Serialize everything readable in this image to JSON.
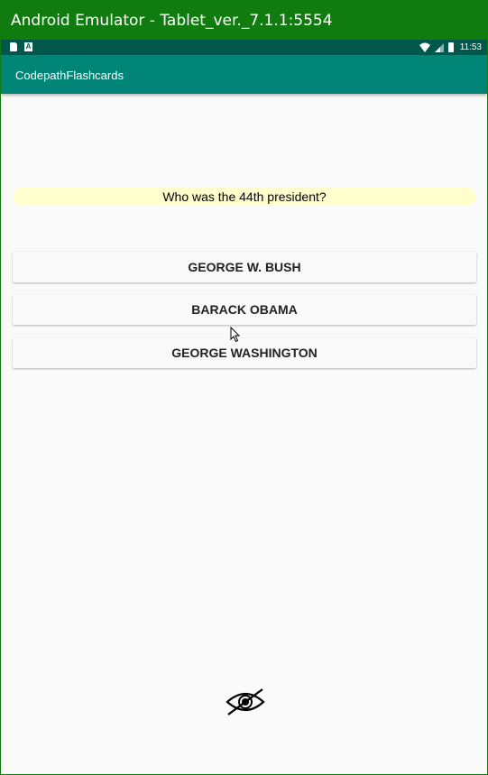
{
  "window": {
    "title": "Android Emulator - Tablet_ver._7.1.1:5554"
  },
  "statusbar": {
    "left_icons": [
      "sd-card-icon",
      "notification-a-icon"
    ],
    "right_icons": [
      "wifi-icon",
      "cell-signal-icon",
      "battery-icon"
    ],
    "time": "11:53",
    "notification_letter": "A"
  },
  "appbar": {
    "title": "CodepathFlashcards"
  },
  "flashcard": {
    "question": "Who was the 44th president?",
    "answers": [
      {
        "label": "GEORGE W. BUSH"
      },
      {
        "label": "BARACK OBAMA"
      },
      {
        "label": "GEORGE WASHINGTON"
      }
    ],
    "toggle_icon": "eye-hidden-icon"
  },
  "colors": {
    "window_titlebar": "#107c10",
    "statusbar": "#00574b",
    "appbar": "#008577",
    "question_bg": "#fffecc",
    "background": "#fafafa"
  }
}
